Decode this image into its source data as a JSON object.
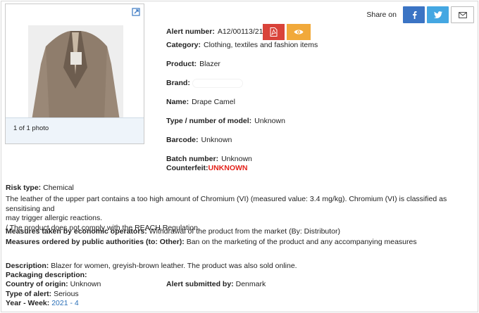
{
  "photo": {
    "counter": "1 of 1 photo",
    "alt": "Photo of blazer"
  },
  "share": {
    "label": "Share on",
    "buttons": [
      "facebook-icon",
      "twitter-icon",
      "mail-icon"
    ]
  },
  "alert": {
    "number_label": "Alert number:",
    "number": "A12/00113/21",
    "category_label": "Category:",
    "category": "Clothing, textiles and fashion items",
    "product_label": "Product:",
    "product": "Blazer",
    "brand_label": "Brand:",
    "brand": "",
    "name_label": "Name:",
    "name": "Drape Camel",
    "model_label": "Type / number of model:",
    "model": "Unknown",
    "barcode_label": "Barcode:",
    "barcode": "Unknown",
    "batch_label": "Batch number:",
    "batch": "Unknown",
    "counterfeit_label": "Counterfeit:",
    "counterfeit": "UNKNOWN"
  },
  "risk": {
    "type_label": "Risk type:",
    "type": "Chemical",
    "line1": "The leather of the upper part contains a too high amount of Chromium (VI) (measured value: 3.4 mg/kg). Chromium (VI) is classified as sensitising and",
    "line2": "may trigger allergic reactions.",
    "line3": "/ The product does not comply with the REACH Regulation."
  },
  "measures": {
    "operators_label": "Measures taken by economic operators:",
    "operators": "Withdrawal of the product from the market (By: Distributor)",
    "authorities_label": "Measures ordered by public authorities (to: Other):",
    "authorities": "Ban on the marketing of the product and any accompanying measures"
  },
  "details": {
    "description_label": "Description:",
    "description": "Blazer for women, greyish-brown leather. The product was also sold online.",
    "packaging_label": "Packaging description:",
    "origin_label": "Country of origin:",
    "origin": "Unknown",
    "submitted_label": "Alert submitted by:",
    "submitted": "Denmark",
    "alert_type_label": "Type of alert:",
    "alert_type": "Serious",
    "year_week_label": "Year - Week:",
    "year_week": "2021 - 4"
  },
  "colors": {
    "pdf": "#d9433a",
    "view": "#f1a93a",
    "facebook": "#3b74c4",
    "twitter": "#44a7e2",
    "counterfeit": "#e3231b",
    "link": "#2a6fb8"
  }
}
